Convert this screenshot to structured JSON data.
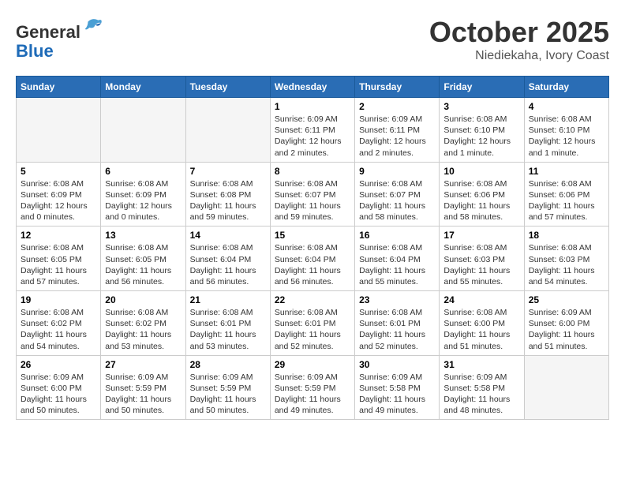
{
  "header": {
    "logo_general": "General",
    "logo_blue": "Blue",
    "month": "October 2025",
    "location": "Niediekaha, Ivory Coast"
  },
  "weekdays": [
    "Sunday",
    "Monday",
    "Tuesday",
    "Wednesday",
    "Thursday",
    "Friday",
    "Saturday"
  ],
  "weeks": [
    [
      {
        "day": "",
        "empty": true
      },
      {
        "day": "",
        "empty": true
      },
      {
        "day": "",
        "empty": true
      },
      {
        "day": "1",
        "sunrise": "6:09 AM",
        "sunset": "6:11 PM",
        "daylight": "12 hours and 2 minutes."
      },
      {
        "day": "2",
        "sunrise": "6:09 AM",
        "sunset": "6:11 PM",
        "daylight": "12 hours and 2 minutes."
      },
      {
        "day": "3",
        "sunrise": "6:08 AM",
        "sunset": "6:10 PM",
        "daylight": "12 hours and 1 minute."
      },
      {
        "day": "4",
        "sunrise": "6:08 AM",
        "sunset": "6:10 PM",
        "daylight": "12 hours and 1 minute."
      }
    ],
    [
      {
        "day": "5",
        "sunrise": "6:08 AM",
        "sunset": "6:09 PM",
        "daylight": "12 hours and 0 minutes."
      },
      {
        "day": "6",
        "sunrise": "6:08 AM",
        "sunset": "6:09 PM",
        "daylight": "12 hours and 0 minutes."
      },
      {
        "day": "7",
        "sunrise": "6:08 AM",
        "sunset": "6:08 PM",
        "daylight": "11 hours and 59 minutes."
      },
      {
        "day": "8",
        "sunrise": "6:08 AM",
        "sunset": "6:07 PM",
        "daylight": "11 hours and 59 minutes."
      },
      {
        "day": "9",
        "sunrise": "6:08 AM",
        "sunset": "6:07 PM",
        "daylight": "11 hours and 58 minutes."
      },
      {
        "day": "10",
        "sunrise": "6:08 AM",
        "sunset": "6:06 PM",
        "daylight": "11 hours and 58 minutes."
      },
      {
        "day": "11",
        "sunrise": "6:08 AM",
        "sunset": "6:06 PM",
        "daylight": "11 hours and 57 minutes."
      }
    ],
    [
      {
        "day": "12",
        "sunrise": "6:08 AM",
        "sunset": "6:05 PM",
        "daylight": "11 hours and 57 minutes."
      },
      {
        "day": "13",
        "sunrise": "6:08 AM",
        "sunset": "6:05 PM",
        "daylight": "11 hours and 56 minutes."
      },
      {
        "day": "14",
        "sunrise": "6:08 AM",
        "sunset": "6:04 PM",
        "daylight": "11 hours and 56 minutes."
      },
      {
        "day": "15",
        "sunrise": "6:08 AM",
        "sunset": "6:04 PM",
        "daylight": "11 hours and 56 minutes."
      },
      {
        "day": "16",
        "sunrise": "6:08 AM",
        "sunset": "6:04 PM",
        "daylight": "11 hours and 55 minutes."
      },
      {
        "day": "17",
        "sunrise": "6:08 AM",
        "sunset": "6:03 PM",
        "daylight": "11 hours and 55 minutes."
      },
      {
        "day": "18",
        "sunrise": "6:08 AM",
        "sunset": "6:03 PM",
        "daylight": "11 hours and 54 minutes."
      }
    ],
    [
      {
        "day": "19",
        "sunrise": "6:08 AM",
        "sunset": "6:02 PM",
        "daylight": "11 hours and 54 minutes."
      },
      {
        "day": "20",
        "sunrise": "6:08 AM",
        "sunset": "6:02 PM",
        "daylight": "11 hours and 53 minutes."
      },
      {
        "day": "21",
        "sunrise": "6:08 AM",
        "sunset": "6:01 PM",
        "daylight": "11 hours and 53 minutes."
      },
      {
        "day": "22",
        "sunrise": "6:08 AM",
        "sunset": "6:01 PM",
        "daylight": "11 hours and 52 minutes."
      },
      {
        "day": "23",
        "sunrise": "6:08 AM",
        "sunset": "6:01 PM",
        "daylight": "11 hours and 52 minutes."
      },
      {
        "day": "24",
        "sunrise": "6:08 AM",
        "sunset": "6:00 PM",
        "daylight": "11 hours and 51 minutes."
      },
      {
        "day": "25",
        "sunrise": "6:09 AM",
        "sunset": "6:00 PM",
        "daylight": "11 hours and 51 minutes."
      }
    ],
    [
      {
        "day": "26",
        "sunrise": "6:09 AM",
        "sunset": "6:00 PM",
        "daylight": "11 hours and 50 minutes."
      },
      {
        "day": "27",
        "sunrise": "6:09 AM",
        "sunset": "5:59 PM",
        "daylight": "11 hours and 50 minutes."
      },
      {
        "day": "28",
        "sunrise": "6:09 AM",
        "sunset": "5:59 PM",
        "daylight": "11 hours and 50 minutes."
      },
      {
        "day": "29",
        "sunrise": "6:09 AM",
        "sunset": "5:59 PM",
        "daylight": "11 hours and 49 minutes."
      },
      {
        "day": "30",
        "sunrise": "6:09 AM",
        "sunset": "5:58 PM",
        "daylight": "11 hours and 49 minutes."
      },
      {
        "day": "31",
        "sunrise": "6:09 AM",
        "sunset": "5:58 PM",
        "daylight": "11 hours and 48 minutes."
      },
      {
        "day": "",
        "empty": true
      }
    ]
  ],
  "labels": {
    "sunrise_prefix": "Sunrise: ",
    "sunset_prefix": "Sunset: ",
    "daylight_prefix": "Daylight: "
  }
}
